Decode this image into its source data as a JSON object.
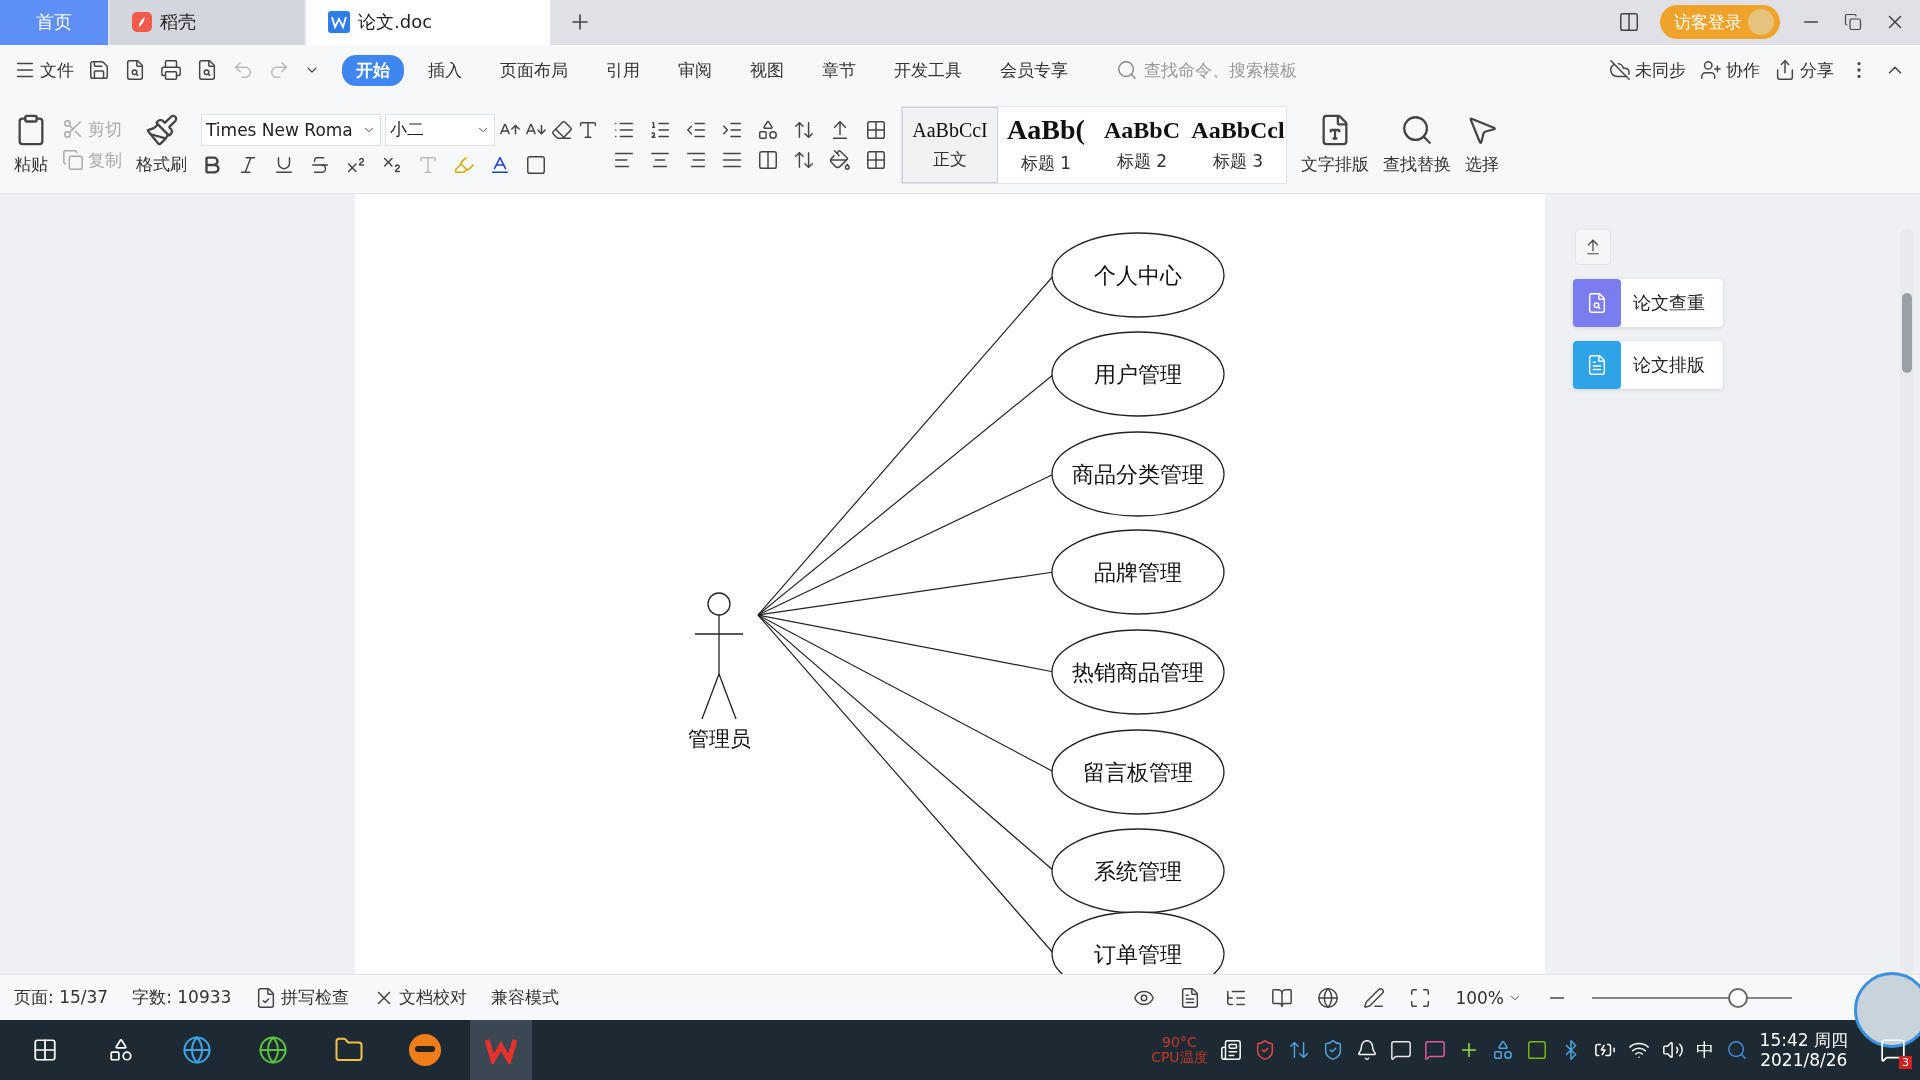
{
  "tabs": [
    {
      "label": "首页",
      "kind": "home",
      "selected": false
    },
    {
      "label": "稻壳",
      "kind": "docer",
      "selected": false
    },
    {
      "label": "论文.doc",
      "kind": "doc",
      "selected": true
    }
  ],
  "title_bar": {
    "login": "访客登录"
  },
  "menu": {
    "file": "文件",
    "tabs": [
      {
        "label": "开始",
        "selected": true
      },
      {
        "label": "插入",
        "selected": false
      },
      {
        "label": "页面布局",
        "selected": false
      },
      {
        "label": "引用",
        "selected": false
      },
      {
        "label": "审阅",
        "selected": false
      },
      {
        "label": "视图",
        "selected": false
      },
      {
        "label": "章节",
        "selected": false
      },
      {
        "label": "开发工具",
        "selected": false
      },
      {
        "label": "会员专享",
        "selected": false
      }
    ],
    "search": {
      "placeholder": "查找命令、搜索模板"
    },
    "actions": [
      "未同步",
      "协作",
      "分享"
    ]
  },
  "ribbon": {
    "paste": "粘贴",
    "cut": {
      "label": "剪切",
      "disabled": true
    },
    "copy": {
      "label": "复制",
      "disabled": true
    },
    "format_painter": "格式刷",
    "font": "Times New Roma",
    "size": "小二",
    "styles": [
      {
        "sample": "AaBbCcI",
        "label": "正文",
        "selected": true,
        "kind": "normal"
      },
      {
        "sample": "AaBb(",
        "label": "标题 1",
        "selected": false,
        "kind": "h1"
      },
      {
        "sample": "AaBbC",
        "label": "标题 2",
        "selected": false,
        "kind": "h2"
      },
      {
        "sample": "AaBbCcl",
        "label": "标题 3",
        "selected": false,
        "kind": "h3"
      }
    ],
    "text_layout": "文字排版",
    "find_replace": "查找替换",
    "select": "选择"
  },
  "side_panel": [
    {
      "label": "论文查重",
      "color": "#7b7cf0"
    },
    {
      "label": "论文排版",
      "color": "#2ea3e8"
    }
  ],
  "diagram": {
    "actor": "管理员",
    "use_cases": [
      "个人中心",
      "用户管理",
      "商品分类管理",
      "品牌管理",
      "热销商品管理",
      "留言板管理",
      "系统管理",
      "订单管理"
    ]
  },
  "status_bar": {
    "page": "页面: 15/37",
    "words": "字数: 10933",
    "spell_check": "拼写检查",
    "proofread": "文档校对",
    "mode": "兼容模式",
    "zoom": "100%",
    "zoom_slider": {
      "level": 0.73
    }
  },
  "taskbar": {
    "cpu_temp": "90°C",
    "cpu_label": "CPU温度",
    "ime": "中",
    "time": "15:42 周四",
    "date": "2021/8/26",
    "notifications": "3"
  }
}
